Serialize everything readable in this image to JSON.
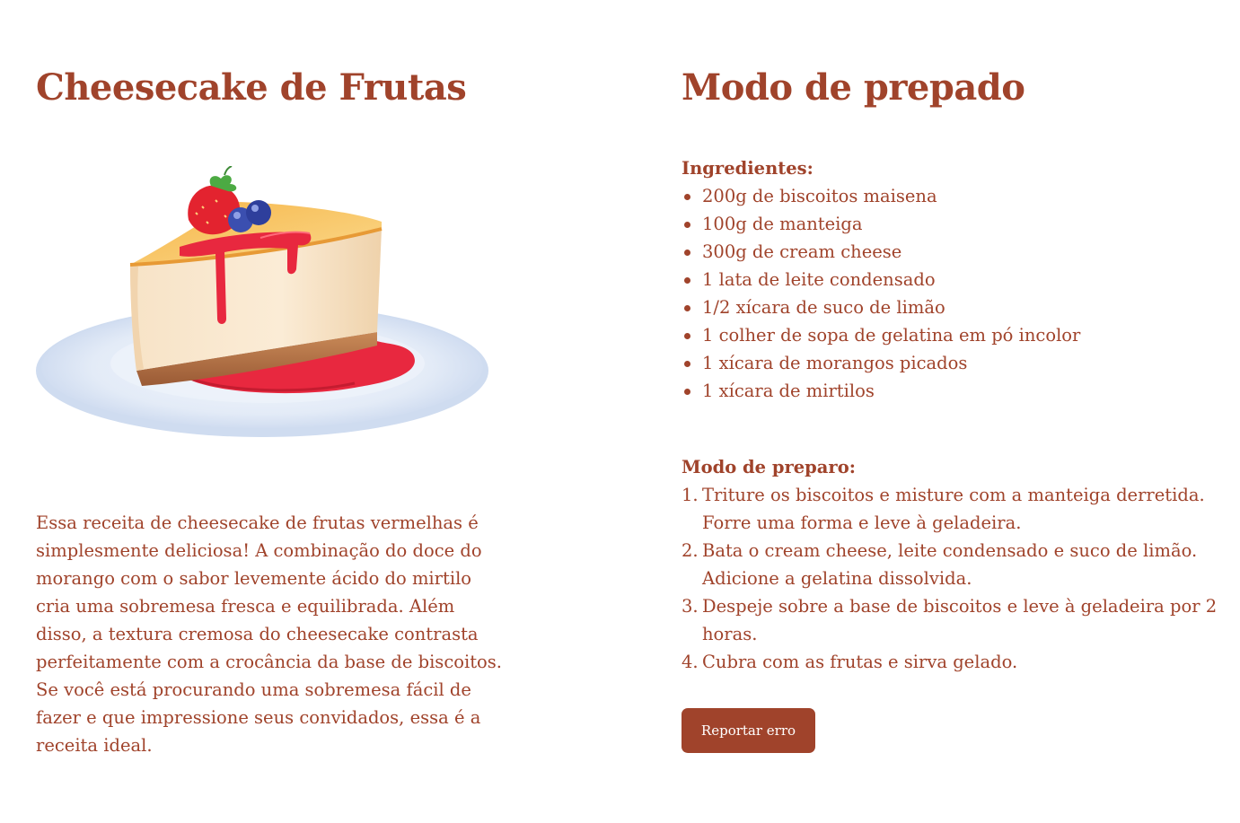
{
  "recipe": {
    "title": "Cheesecake de Frutas",
    "description": "Essa receita de cheesecake de frutas vermelhas é simplesmente deliciosa! A combinação do doce do morango com o sabor levemente ácido do mirtilo cria uma sobremesa fresca e equilibrada. Além disso, a textura cremosa do cheesecake contrasta perfeitamente com a crocância da base de biscoitos. Se você está procurando uma sobremesa fácil de fazer e que impressione seus convidados, essa é a receita ideal."
  },
  "preparation": {
    "title": "Modo de prepado",
    "ingredients_label": "Ingredientes:",
    "ingredients": [
      "200g de biscoitos maisena",
      "100g de manteiga",
      "300g de cream cheese",
      "1 lata de leite condensado",
      "1/2 xícara de suco de limão",
      "1 colher de sopa de gelatina em pó incolor",
      "1 xícara de morangos picados",
      "1 xícara de mirtilos"
    ],
    "steps_label": "Modo de preparo:",
    "steps": [
      {
        "num": "1.",
        "text": "Triture os biscoitos e misture com a manteiga derretida. Forre uma forma e leve à geladeira."
      },
      {
        "num": "2.",
        "text": "Bata o cream cheese, leite condensado e suco de limão. Adicione a gelatina dissolvida."
      },
      {
        "num": "3.",
        "text": "Despeje sobre a base de biscoitos e leve à geladeira por 2 horas."
      },
      {
        "num": "4.",
        "text": "Cubra com as frutas e sirva gelado."
      }
    ]
  },
  "actions": {
    "report_label": "Reportar erro"
  },
  "colors": {
    "accent": "#a0432b",
    "background": "#ffffff"
  }
}
